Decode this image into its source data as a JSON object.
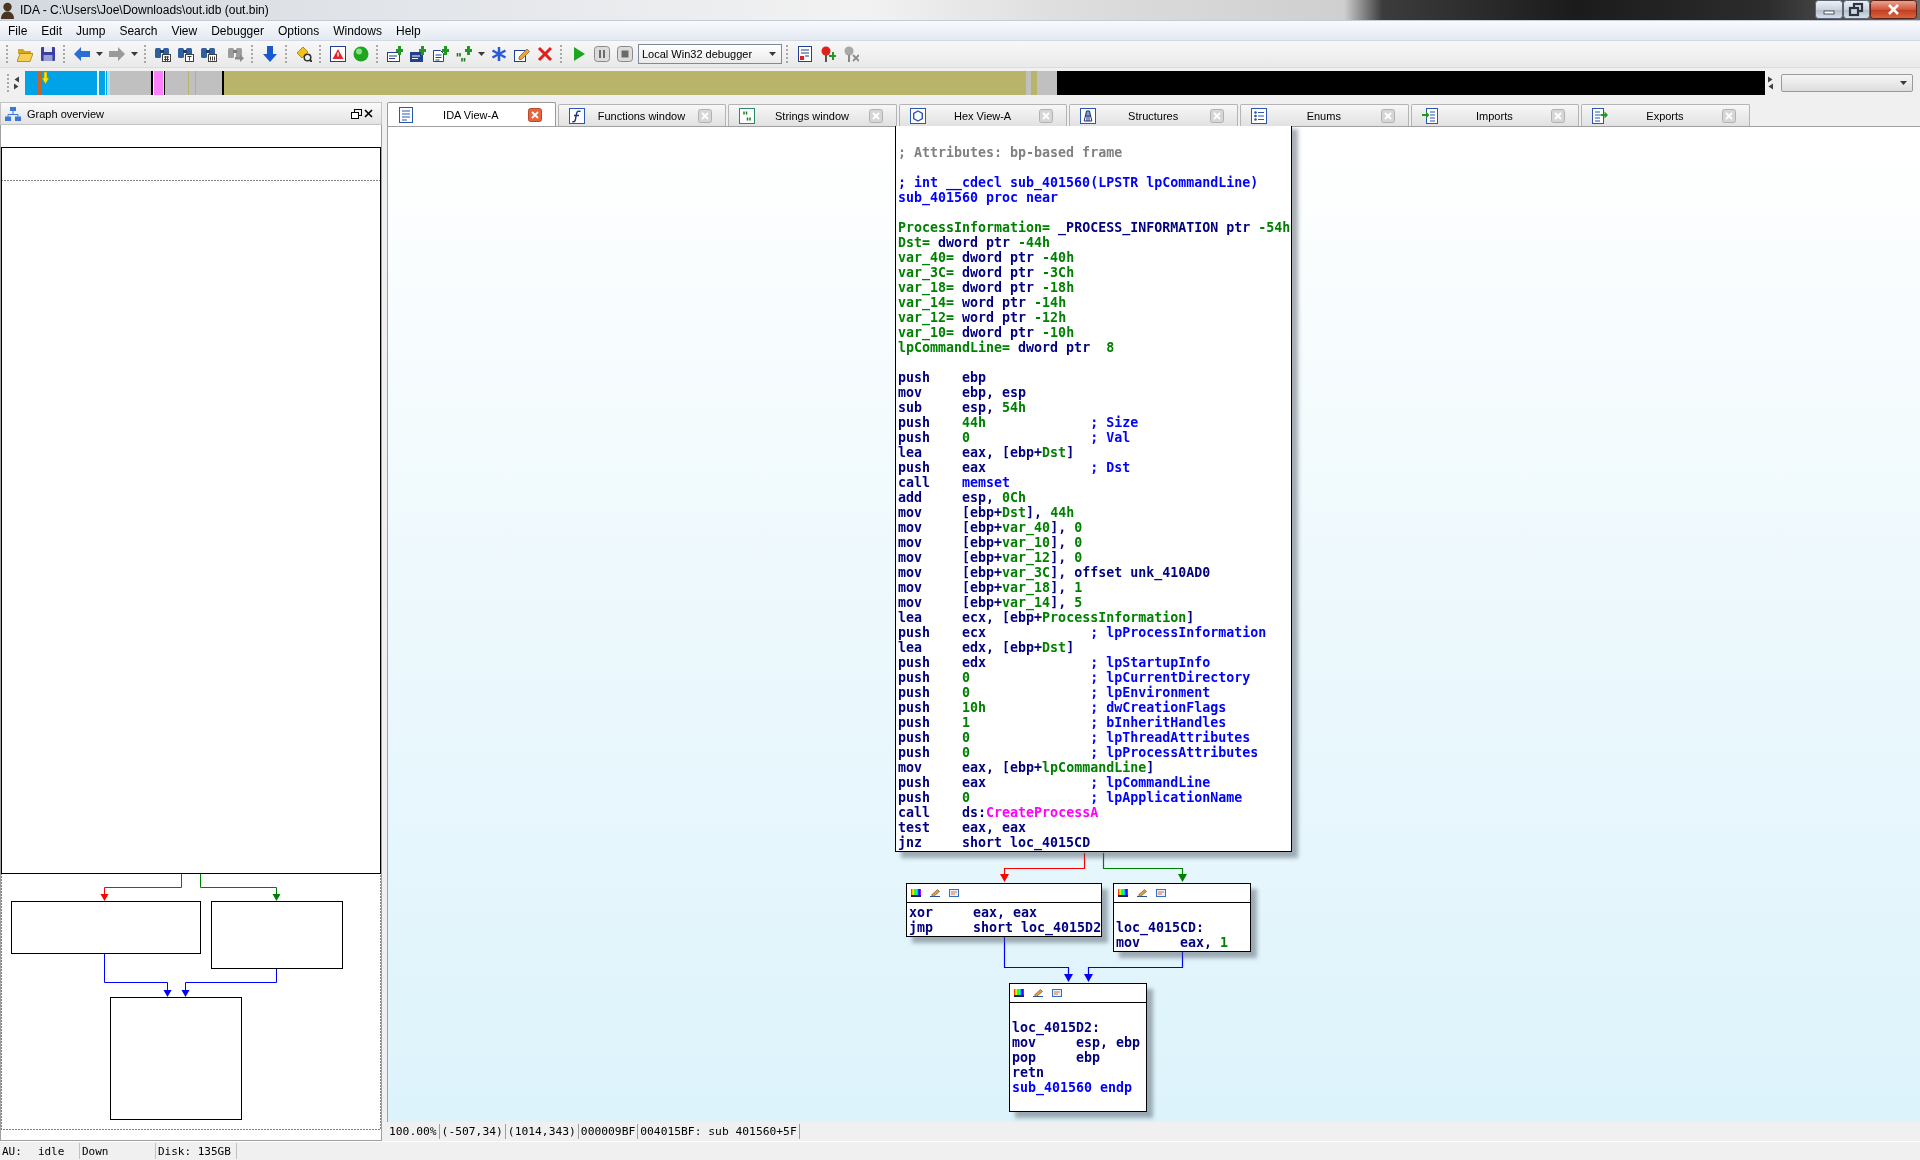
{
  "window": {
    "title": "IDA - C:\\Users\\Joe\\Downloads\\out.idb (out.bin)"
  },
  "menu": [
    "File",
    "Edit",
    "Jump",
    "Search",
    "View",
    "Debugger",
    "Options",
    "Windows",
    "Help"
  ],
  "toolbar": {
    "debugger": "Local Win32 debugger"
  },
  "overview_panel": {
    "title": "Graph overview"
  },
  "tabs": [
    {
      "label": "IDA View-A",
      "selected": true
    },
    {
      "label": "Functions window",
      "selected": false
    },
    {
      "label": "Strings window",
      "selected": false
    },
    {
      "label": "Hex View-A",
      "selected": false
    },
    {
      "label": "Structures",
      "selected": false
    },
    {
      "label": "Enums",
      "selected": false
    },
    {
      "label": "Imports",
      "selected": false
    },
    {
      "label": "Exports",
      "selected": false
    }
  ],
  "graph": {
    "nodes": [
      {
        "header": false,
        "lines": [
          {
            "kind": "text",
            "segments": [
              {
                "kind": "attribute_comment",
                "text": "; Attributes: bp-based frame"
              }
            ]
          },
          {
            "kind": "blank"
          },
          {
            "kind": "text",
            "segments": [
              {
                "kind": "function",
                "text": "; int __cdecl sub_401560(LPSTR lpCommandLine)"
              }
            ]
          },
          {
            "kind": "text",
            "segments": [
              {
                "kind": "function",
                "text": "sub_401560 proc near"
              }
            ]
          },
          {
            "kind": "blank"
          },
          {
            "kind": "text",
            "segments": [
              {
                "kind": "stack_var",
                "text": "ProcessInformation="
              },
              {
                "kind": "plain",
                "text": " _PROCESS_INFORMATION ptr "
              },
              {
                "kind": "number",
                "text": "-54h"
              }
            ]
          },
          {
            "kind": "text",
            "segments": [
              {
                "kind": "stack_var",
                "text": "Dst="
              },
              {
                "kind": "plain",
                "text": " dword ptr "
              },
              {
                "kind": "number",
                "text": "-44h"
              }
            ]
          },
          {
            "kind": "text",
            "segments": [
              {
                "kind": "stack_var",
                "text": "var_40="
              },
              {
                "kind": "plain",
                "text": " dword ptr "
              },
              {
                "kind": "number",
                "text": "-40h"
              }
            ]
          },
          {
            "kind": "text",
            "segments": [
              {
                "kind": "stack_var",
                "text": "var_3C="
              },
              {
                "kind": "plain",
                "text": " dword ptr "
              },
              {
                "kind": "number",
                "text": "-3Ch"
              }
            ]
          },
          {
            "kind": "text",
            "segments": [
              {
                "kind": "stack_var",
                "text": "var_18="
              },
              {
                "kind": "plain",
                "text": " dword ptr "
              },
              {
                "kind": "number",
                "text": "-18h"
              }
            ]
          },
          {
            "kind": "text",
            "segments": [
              {
                "kind": "stack_var",
                "text": "var_14="
              },
              {
                "kind": "plain",
                "text": " word ptr "
              },
              {
                "kind": "number",
                "text": "-14h"
              }
            ]
          },
          {
            "kind": "text",
            "segments": [
              {
                "kind": "stack_var",
                "text": "var_12="
              },
              {
                "kind": "plain",
                "text": " word ptr "
              },
              {
                "kind": "number",
                "text": "-12h"
              }
            ]
          },
          {
            "kind": "text",
            "segments": [
              {
                "kind": "stack_var",
                "text": "var_10="
              },
              {
                "kind": "plain",
                "text": " dword ptr "
              },
              {
                "kind": "number",
                "text": "-10h"
              }
            ]
          },
          {
            "kind": "text",
            "segments": [
              {
                "kind": "stack_var",
                "text": "lpCommandLine="
              },
              {
                "kind": "plain",
                "text": " dword ptr  "
              },
              {
                "kind": "number",
                "text": "8"
              }
            ]
          },
          {
            "kind": "blank"
          },
          {
            "kind": "instruction",
            "mnemonic": "push",
            "operands": [
              {
                "kind": "plain",
                "text": "ebp"
              }
            ]
          },
          {
            "kind": "instruction",
            "mnemonic": "mov",
            "operands": [
              {
                "kind": "plain",
                "text": "ebp, esp"
              }
            ]
          },
          {
            "kind": "instruction",
            "mnemonic": "sub",
            "operands": [
              {
                "kind": "plain",
                "text": "esp, "
              },
              {
                "kind": "number",
                "text": "54h"
              }
            ]
          },
          {
            "kind": "instruction",
            "mnemonic": "push",
            "operands": [
              {
                "kind": "number",
                "text": "44h"
              }
            ],
            "comment": "; Size"
          },
          {
            "kind": "instruction",
            "mnemonic": "push",
            "operands": [
              {
                "kind": "number",
                "text": "0"
              }
            ],
            "comment": "; Val"
          },
          {
            "kind": "instruction",
            "mnemonic": "lea",
            "operands": [
              {
                "kind": "plain",
                "text": "eax, [ebp+"
              },
              {
                "kind": "stack_var",
                "text": "Dst"
              },
              {
                "kind": "plain",
                "text": "]"
              }
            ]
          },
          {
            "kind": "instruction",
            "mnemonic": "push",
            "operands": [
              {
                "kind": "plain",
                "text": "eax"
              }
            ],
            "comment": "; Dst"
          },
          {
            "kind": "instruction",
            "mnemonic": "call",
            "operands": [
              {
                "kind": "function",
                "text": "memset"
              }
            ]
          },
          {
            "kind": "instruction",
            "mnemonic": "add",
            "operands": [
              {
                "kind": "plain",
                "text": "esp, "
              },
              {
                "kind": "number",
                "text": "0Ch"
              }
            ]
          },
          {
            "kind": "instruction",
            "mnemonic": "mov",
            "operands": [
              {
                "kind": "plain",
                "text": "[ebp+"
              },
              {
                "kind": "stack_var",
                "text": "Dst"
              },
              {
                "kind": "plain",
                "text": "], "
              },
              {
                "kind": "number",
                "text": "44h"
              }
            ]
          },
          {
            "kind": "instruction",
            "mnemonic": "mov",
            "operands": [
              {
                "kind": "plain",
                "text": "[ebp+"
              },
              {
                "kind": "stack_var",
                "text": "var_40"
              },
              {
                "kind": "plain",
                "text": "], "
              },
              {
                "kind": "number",
                "text": "0"
              }
            ]
          },
          {
            "kind": "instruction",
            "mnemonic": "mov",
            "operands": [
              {
                "kind": "plain",
                "text": "[ebp+"
              },
              {
                "kind": "stack_var",
                "text": "var_10"
              },
              {
                "kind": "plain",
                "text": "], "
              },
              {
                "kind": "number",
                "text": "0"
              }
            ]
          },
          {
            "kind": "instruction",
            "mnemonic": "mov",
            "operands": [
              {
                "kind": "plain",
                "text": "[ebp+"
              },
              {
                "kind": "stack_var",
                "text": "var_12"
              },
              {
                "kind": "plain",
                "text": "], "
              },
              {
                "kind": "number",
                "text": "0"
              }
            ]
          },
          {
            "kind": "instruction",
            "mnemonic": "mov",
            "operands": [
              {
                "kind": "plain",
                "text": "[ebp+"
              },
              {
                "kind": "stack_var",
                "text": "var_3C"
              },
              {
                "kind": "plain",
                "text": "], offset unk_410AD0"
              }
            ]
          },
          {
            "kind": "instruction",
            "mnemonic": "mov",
            "operands": [
              {
                "kind": "plain",
                "text": "[ebp+"
              },
              {
                "kind": "stack_var",
                "text": "var_18"
              },
              {
                "kind": "plain",
                "text": "], "
              },
              {
                "kind": "number",
                "text": "1"
              }
            ]
          },
          {
            "kind": "instruction",
            "mnemonic": "mov",
            "operands": [
              {
                "kind": "plain",
                "text": "[ebp+"
              },
              {
                "kind": "stack_var",
                "text": "var_14"
              },
              {
                "kind": "plain",
                "text": "], "
              },
              {
                "kind": "number",
                "text": "5"
              }
            ]
          },
          {
            "kind": "instruction",
            "mnemonic": "lea",
            "operands": [
              {
                "kind": "plain",
                "text": "ecx, [ebp+"
              },
              {
                "kind": "stack_var",
                "text": "ProcessInformation"
              },
              {
                "kind": "plain",
                "text": "]"
              }
            ]
          },
          {
            "kind": "instruction",
            "mnemonic": "push",
            "operands": [
              {
                "kind": "plain",
                "text": "ecx"
              }
            ],
            "comment": "; lpProcessInformation"
          },
          {
            "kind": "instruction",
            "mnemonic": "lea",
            "operands": [
              {
                "kind": "plain",
                "text": "edx, [ebp+"
              },
              {
                "kind": "stack_var",
                "text": "Dst"
              },
              {
                "kind": "plain",
                "text": "]"
              }
            ]
          },
          {
            "kind": "instruction",
            "mnemonic": "push",
            "operands": [
              {
                "kind": "plain",
                "text": "edx"
              }
            ],
            "comment": "; lpStartupInfo"
          },
          {
            "kind": "instruction",
            "mnemonic": "push",
            "operands": [
              {
                "kind": "number",
                "text": "0"
              }
            ],
            "comment": "; lpCurrentDirectory"
          },
          {
            "kind": "instruction",
            "mnemonic": "push",
            "operands": [
              {
                "kind": "number",
                "text": "0"
              }
            ],
            "comment": "; lpEnvironment"
          },
          {
            "kind": "instruction",
            "mnemonic": "push",
            "operands": [
              {
                "kind": "number",
                "text": "10h"
              }
            ],
            "comment": "; dwCreationFlags"
          },
          {
            "kind": "instruction",
            "mnemonic": "push",
            "operands": [
              {
                "kind": "number",
                "text": "1"
              }
            ],
            "comment": "; bInheritHandles"
          },
          {
            "kind": "instruction",
            "mnemonic": "push",
            "operands": [
              {
                "kind": "number",
                "text": "0"
              }
            ],
            "comment": "; lpThreadAttributes"
          },
          {
            "kind": "instruction",
            "mnemonic": "push",
            "operands": [
              {
                "kind": "number",
                "text": "0"
              }
            ],
            "comment": "; lpProcessAttributes"
          },
          {
            "kind": "instruction",
            "mnemonic": "mov",
            "operands": [
              {
                "kind": "plain",
                "text": "eax, [ebp+"
              },
              {
                "kind": "stack_var",
                "text": "lpCommandLine"
              },
              {
                "kind": "plain",
                "text": "]"
              }
            ]
          },
          {
            "kind": "instruction",
            "mnemonic": "push",
            "operands": [
              {
                "kind": "plain",
                "text": "eax"
              }
            ],
            "comment": "; lpCommandLine"
          },
          {
            "kind": "instruction",
            "mnemonic": "push",
            "operands": [
              {
                "kind": "number",
                "text": "0"
              }
            ],
            "comment": "; lpApplicationName"
          },
          {
            "kind": "instruction",
            "mnemonic": "call",
            "operands": [
              {
                "kind": "plain",
                "text": "ds:"
              },
              {
                "kind": "import",
                "text": "CreateProcessA"
              }
            ]
          },
          {
            "kind": "instruction",
            "mnemonic": "test",
            "operands": [
              {
                "kind": "plain",
                "text": "eax, eax"
              }
            ]
          },
          {
            "kind": "instruction",
            "mnemonic": "jnz",
            "operands": [
              {
                "kind": "plain",
                "text": "short loc_4015CD"
              }
            ]
          }
        ]
      },
      {
        "header": true,
        "lines": [
          {
            "kind": "instruction",
            "mnemonic": "xor",
            "operands": [
              {
                "kind": "plain",
                "text": "eax, eax"
              }
            ]
          },
          {
            "kind": "instruction",
            "mnemonic": "jmp",
            "operands": [
              {
                "kind": "plain",
                "text": "short loc_4015D2"
              }
            ]
          }
        ]
      },
      {
        "header": true,
        "lines": [
          {
            "kind": "blank"
          },
          {
            "kind": "text",
            "segments": [
              {
                "kind": "label",
                "text": "loc_4015CD:"
              }
            ]
          },
          {
            "kind": "instruction",
            "mnemonic": "mov",
            "operands": [
              {
                "kind": "plain",
                "text": "eax, "
              },
              {
                "kind": "number",
                "text": "1"
              }
            ]
          }
        ]
      },
      {
        "header": true,
        "lines": [
          {
            "kind": "blank"
          },
          {
            "kind": "text",
            "segments": [
              {
                "kind": "label",
                "text": "loc_4015D2:"
              }
            ]
          },
          {
            "kind": "instruction",
            "mnemonic": "mov",
            "operands": [
              {
                "kind": "plain",
                "text": "esp, ebp"
              }
            ]
          },
          {
            "kind": "instruction",
            "mnemonic": "pop",
            "operands": [
              {
                "kind": "plain",
                "text": "ebp"
              }
            ]
          },
          {
            "kind": "instruction",
            "mnemonic": "retn"
          },
          {
            "kind": "text",
            "segments": [
              {
                "kind": "function",
                "text": "sub_401560 endp"
              }
            ]
          },
          {
            "kind": "blank"
          }
        ]
      }
    ],
    "edges": [
      {
        "color": "#ff0000"
      },
      {
        "color": "#008000"
      },
      {
        "color": "#0000ff"
      },
      {
        "color": "#0000ff"
      }
    ]
  },
  "graph_status": [
    "100.00%",
    "(-507,34)",
    "(1014,343)",
    "000009BF",
    "004015BF: sub 401560+5F"
  ],
  "status_bar": [
    {
      "label": "AU:",
      "value": "idle"
    },
    {
      "value": "Down"
    },
    {
      "value": "Disk: 135GB"
    }
  ]
}
